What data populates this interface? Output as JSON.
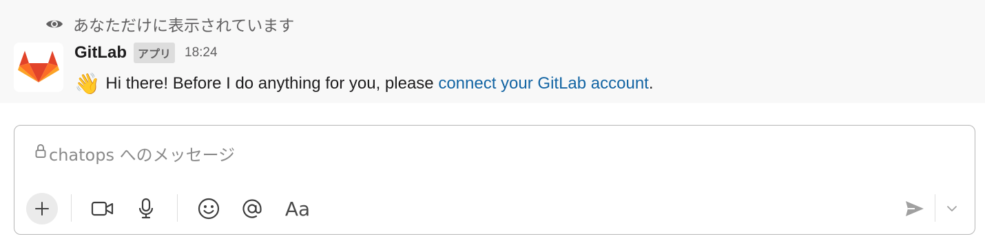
{
  "ephemeral": {
    "text": "あなただけに表示されています",
    "icon": "eye-icon"
  },
  "message": {
    "sender": "GitLab",
    "badge": "アプリ",
    "time": "18:24",
    "emoji": "👋",
    "text_before": "Hi there! Before I do anything for you, please ",
    "link_text": "connect your GitLab account",
    "text_after": "."
  },
  "composer": {
    "placeholder": "chatops へのメッセージ",
    "lock_icon": "lock-icon",
    "toolbar": [
      "plus-icon",
      "video-icon",
      "microphone-icon",
      "emoji-icon",
      "mention-icon",
      "text-format-icon"
    ],
    "text_format_label": "Aa",
    "send_icon": "send-icon",
    "schedule_icon": "chevron-down-icon"
  },
  "colors": {
    "link": "#1264a3",
    "message_bg": "#f8f8f8",
    "gitlab_orange": "#e24329"
  }
}
